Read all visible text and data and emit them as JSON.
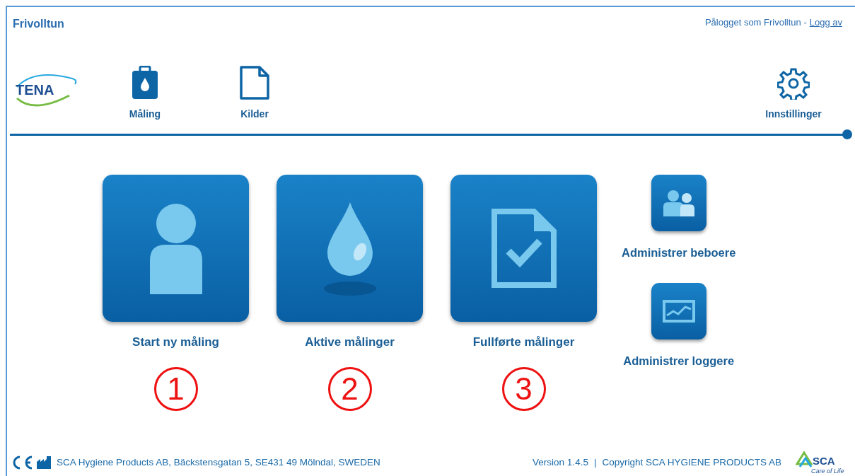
{
  "header": {
    "title": "Frivolltun",
    "login_text": "Pålogget som Frivolltun -",
    "logout_link": "Logg av"
  },
  "logo": {
    "text": "TENA"
  },
  "nav": [
    {
      "label": "Måling"
    },
    {
      "label": "Kilder"
    },
    {
      "label": "Innstillinger"
    }
  ],
  "tiles": [
    {
      "label": "Start ny måling",
      "annotation": "1"
    },
    {
      "label": "Aktive målinger",
      "annotation": "2"
    },
    {
      "label": "Fullførte målinger",
      "annotation": "3"
    }
  ],
  "side_tiles": [
    {
      "label": "Administrer beboere"
    },
    {
      "label": "Administrer loggere"
    }
  ],
  "footer": {
    "address": "SCA Hygiene Products AB, Bäckstensgatan 5, SE431 49 Mölndal, SWEDEN",
    "version": "Version 1.4.5",
    "separator": "|",
    "copyright": "Copyright SCA HYGIENE PRODUCTS AB",
    "logo_text": "SCA",
    "logo_tagline": "Care of Life"
  }
}
